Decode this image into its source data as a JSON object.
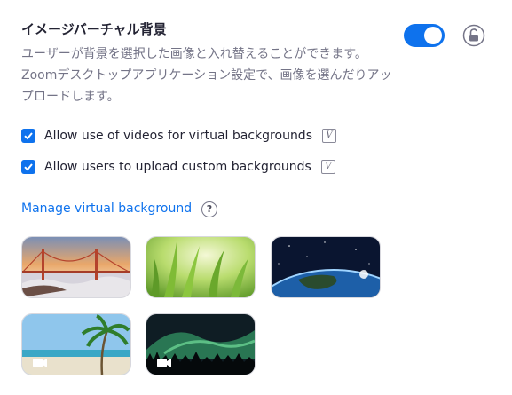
{
  "setting": {
    "title": "イメージバーチャル背景",
    "description": "ユーザーが背景を選択した画像と入れ替えることができます。Zoomデスクトップアプリケーション設定で、画像を選んだりアップロードします。",
    "toggle_on": true
  },
  "options": [
    {
      "label": "Allow use of videos for virtual backgrounds",
      "checked": true
    },
    {
      "label": "Allow users to upload custom backgrounds",
      "checked": true
    }
  ],
  "manage_link": "Manage virtual background",
  "help_glyph": "?",
  "version_glyph": "V",
  "backgrounds": [
    {
      "name": "golden-gate",
      "is_video": false
    },
    {
      "name": "grass",
      "is_video": false
    },
    {
      "name": "earth",
      "is_video": false
    },
    {
      "name": "beach",
      "is_video": true
    },
    {
      "name": "aurora",
      "is_video": true
    }
  ],
  "colors": {
    "accent": "#0e72ed",
    "text": "#232333",
    "muted": "#747487"
  }
}
